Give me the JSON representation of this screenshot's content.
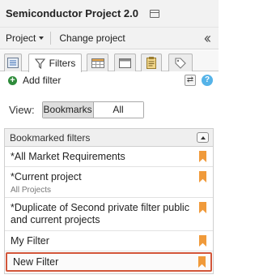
{
  "header": {
    "title": "Semiconductor Project 2.0"
  },
  "menubar": {
    "project_label": "Project",
    "change_project_label": "Change project"
  },
  "tabs": {
    "items": [
      {
        "name": "list-view",
        "icon": "list-icon"
      },
      {
        "name": "filters",
        "label": "Filters",
        "icon": "funnel-icon",
        "active": true
      },
      {
        "name": "grid",
        "icon": "grid-icon"
      },
      {
        "name": "window",
        "icon": "window-icon"
      },
      {
        "name": "clipboard",
        "icon": "clipboard-icon"
      },
      {
        "name": "tag",
        "icon": "tag-icon"
      }
    ]
  },
  "toolbar": {
    "add_filter_label": "Add filter",
    "add_icon": "plus-circle-icon",
    "refresh_icon": "refresh-icon",
    "help_icon": "help-icon"
  },
  "view": {
    "label": "View:",
    "options": [
      "Bookmarks",
      "All"
    ],
    "selected": "Bookmarks"
  },
  "panel": {
    "title": "Bookmarked filters",
    "filters": [
      {
        "name": "*All Market Requirements",
        "subtitle": ""
      },
      {
        "name": "*Current project",
        "subtitle": "All Projects"
      },
      {
        "name": "*Duplicate of Second private filter public and current projects",
        "subtitle": ""
      },
      {
        "name": "My Filter",
        "subtitle": ""
      },
      {
        "name": "New Filter",
        "subtitle": "",
        "selected": true
      }
    ]
  },
  "colors": {
    "bookmark": "#f09a3a",
    "selected_border": "#d2563a",
    "add_icon": "#2e8b3a",
    "help_icon": "#55b3e8"
  }
}
